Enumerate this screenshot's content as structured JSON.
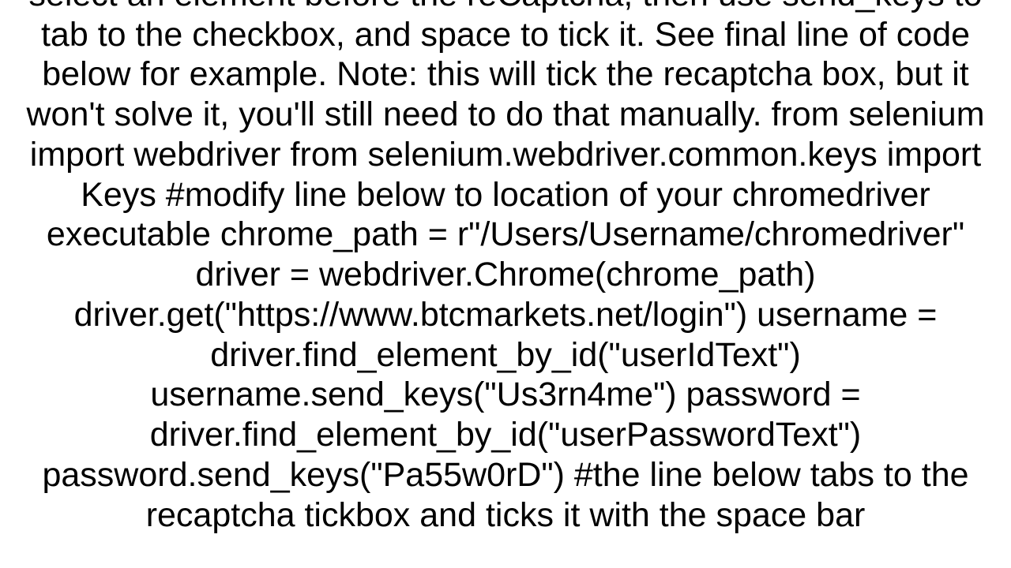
{
  "body_text": "select an element before the reCaptcha, then use send_keys to tab to the checkbox, and space to tick it. See final line of code below for example. Note: this will tick the recaptcha box, but it won't solve it, you'll still need to do that manually. from selenium import webdriver from selenium.webdriver.common.keys import Keys  #modify line below to location of your chromedriver executable chrome_path = r\"/Users/Username/chromedriver\" driver = webdriver.Chrome(chrome_path) driver.get(\"https://www.btcmarkets.net/login\")  username = driver.find_element_by_id(\"userIdText\") username.send_keys(\"Us3rn4me\")  password = driver.find_element_by_id(\"userPasswordText\") password.send_keys(\"Pa55w0rD\")  #the line below tabs to the recaptcha tickbox and ticks it with the space bar"
}
